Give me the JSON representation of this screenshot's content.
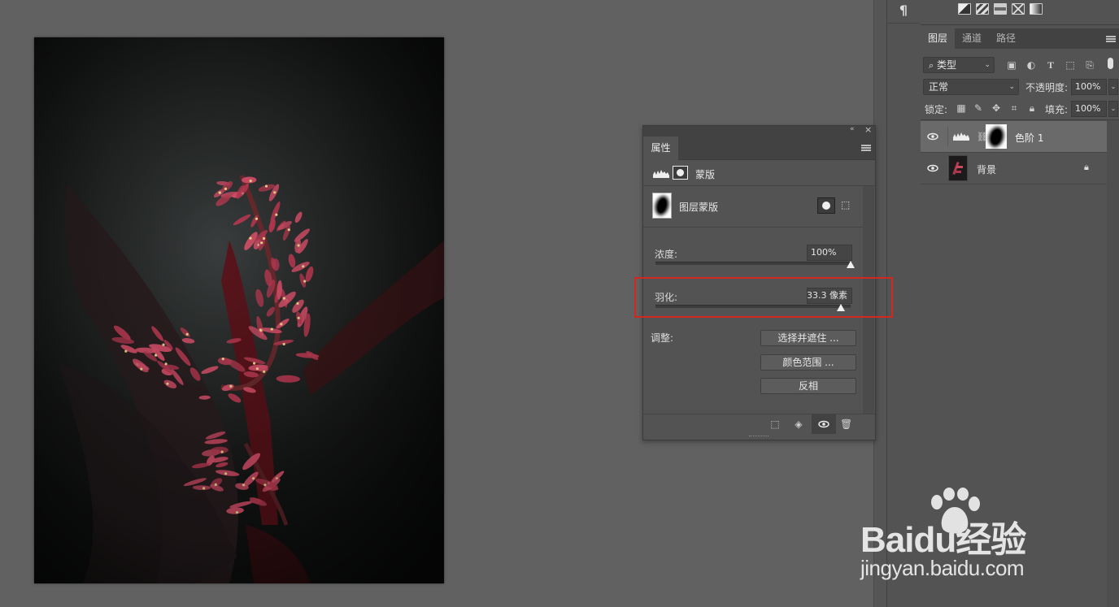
{
  "panel_toolbar": {
    "paragraph_icon": "¶",
    "adjust_icons": [
      "gradient-map-icon",
      "brightness-icon",
      "curves-icon",
      "hue-icon",
      "levels-gradient-icon"
    ]
  },
  "layers_panel": {
    "tabs": [
      "图层",
      "通道",
      "路径"
    ],
    "filter": {
      "label": "类型"
    },
    "blend_mode": "正常",
    "opacity_label": "不透明度:",
    "opacity_value": "100%",
    "lock_label": "锁定:",
    "fill_label": "填充:",
    "fill_value": "100%",
    "layers": [
      {
        "name": "色阶 1",
        "selected": true,
        "kind": "adjustment"
      },
      {
        "name": "背景",
        "selected": false,
        "locked": true,
        "kind": "image"
      }
    ]
  },
  "properties_panel": {
    "tab": "属性",
    "section": "蒙版",
    "mask_type": "图层蒙版",
    "density": {
      "label": "浓度:",
      "value": "100%",
      "level": 1.0
    },
    "feather": {
      "label": "羽化:",
      "value": "33.3 像素",
      "level": 0.95
    },
    "adjust_label": "调整:",
    "buttons": [
      "选择并遮住 ...",
      "颜色范围 ...",
      "反相"
    ]
  },
  "watermark": {
    "brand": "Baidu经验",
    "site": "jingyan.baidu.com"
  },
  "colors": {
    "canvas_bg": "#616161",
    "panel": "#535353",
    "highlight": "#d3271f",
    "flower": "#d8506a"
  }
}
